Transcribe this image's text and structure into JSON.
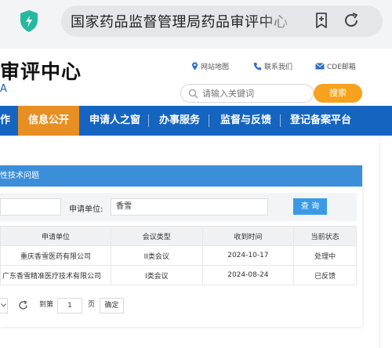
{
  "browser": {
    "url_title": "国家药品监督管理局药品审评中心",
    "colors": {
      "shield": "#27b8a0"
    }
  },
  "header": {
    "title": "审评中心",
    "subtitle": "A",
    "links": [
      {
        "label": "网站地图",
        "icon": "location-pin-icon"
      },
      {
        "label": "联系我们",
        "icon": "phone-icon"
      },
      {
        "label": "CDE邮箱",
        "icon": "mail-icon"
      }
    ],
    "search": {
      "placeholder": "请输入关键词",
      "button": "搜索"
    }
  },
  "nav": {
    "items": [
      "作",
      "信息公开",
      "申请人之窗",
      "办事服务",
      "监督与反馈",
      "登记备案平台"
    ],
    "active": "信息公开",
    "colors": {
      "bar": "#1565c0",
      "active": "#e88f23"
    }
  },
  "panel": {
    "title": "性技术问题",
    "filter": {
      "applicant_label": "申请单位:",
      "applicant_value": "香雪",
      "query_button": "查 询"
    },
    "table": {
      "headers": [
        "申请单位",
        "会议类型",
        "收到时间",
        "当前状态"
      ],
      "rows": [
        [
          "重庆香雪医药有限公司",
          "II类会议",
          "2024-10-17",
          "处理中"
        ],
        [
          "广东香雪精准医疗技术有限公司",
          "I类会议",
          "2024-08-24",
          "已反馈"
        ]
      ]
    },
    "pager": {
      "goto_label": "到第",
      "page_value": "1",
      "page_unit": "页",
      "confirm": "确定"
    }
  }
}
